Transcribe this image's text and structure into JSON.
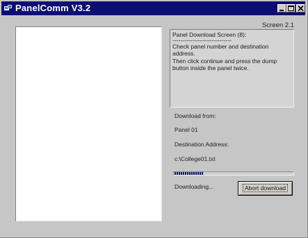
{
  "window": {
    "title": "PanelComm V3.2",
    "controls": [
      "minimize-icon",
      "maximize-icon",
      "close-icon"
    ]
  },
  "screen_label": "Screen 2.1",
  "info": {
    "heading": "Panel Download Screen (8):",
    "divider": "------------------------------",
    "line1": "Check panel number and destination address.",
    "line2": "Then click continue and press the dump button inside the panel twice."
  },
  "download": {
    "from_label": "Download from:",
    "from_value": "Panel 01",
    "dest_label": "Destination Address:",
    "dest_value": "c:\\College01.txt",
    "progress_fraction": 0.24,
    "status": "Downloading...",
    "abort_label": "Abort download"
  },
  "colors": {
    "titlebar": "#0e0e72",
    "window_bg": "#c6c6c6",
    "progress": "#0e0e72"
  }
}
